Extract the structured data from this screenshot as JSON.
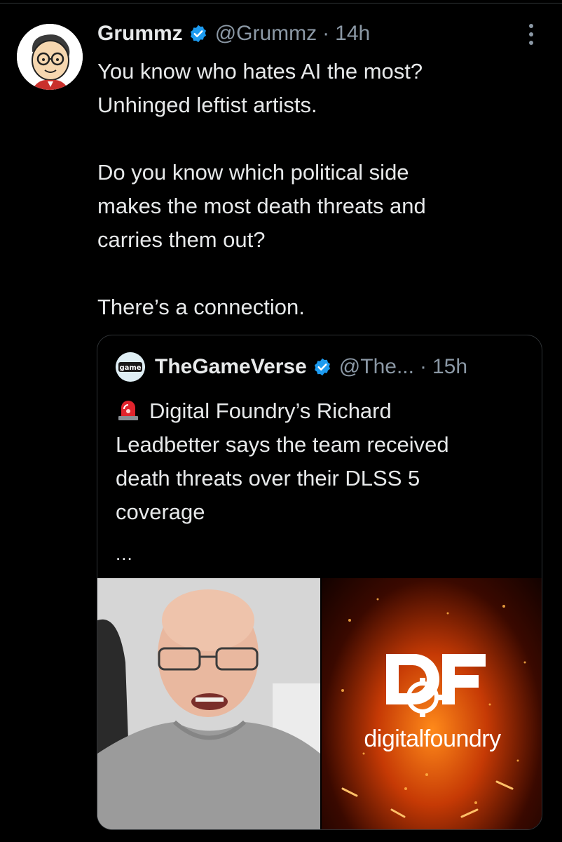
{
  "tweet": {
    "author_name": "Grummz",
    "author_handle": "@Grummz",
    "separator": "·",
    "time": "14h",
    "lines": [
      "You know who hates AI the most?",
      "Unhinged leftist artists.",
      "",
      "Do you know which political side",
      "makes the most death threats and",
      "carries them out?",
      "",
      "There’s a connection."
    ]
  },
  "quote": {
    "author_name": "TheGameVerse",
    "author_handle": "@The...",
    "separator": "·",
    "time": "15h",
    "avatar_text": "game",
    "text_lines": [
      "Digital Foundry’s Richard",
      "Leadbetter says the team received",
      "death threats over their DLSS 5",
      "coverage"
    ],
    "ellipsis": "...",
    "media": {
      "right_logo_text": "DF",
      "right_brand_text": "digitalfoundry"
    }
  },
  "colors": {
    "background": "#000000",
    "text": "#e7e9ea",
    "muted": "#8b98a5",
    "border": "#2f3336",
    "verified": "#1d9bf0"
  },
  "icons": [
    "verified-badge-icon",
    "more-options-icon",
    "siren-icon"
  ]
}
